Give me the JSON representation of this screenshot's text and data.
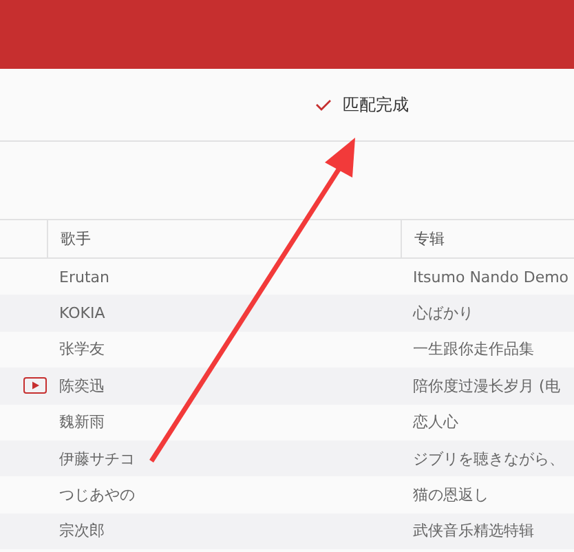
{
  "status": {
    "text": "匹配完成"
  },
  "table": {
    "columns": [
      "歌手",
      "专辑"
    ],
    "rows": [
      {
        "artist": "Erutan",
        "album": "Itsumo Nando Demo",
        "playing": false
      },
      {
        "artist": "KOKIA",
        "album": "心ばかり",
        "playing": false
      },
      {
        "artist": "张学友",
        "album": "一生跟你走作品集",
        "playing": false
      },
      {
        "artist": "陈奕迅",
        "album": "陪你度过漫长岁月 (电",
        "playing": true
      },
      {
        "artist": "魏新雨",
        "album": "恋人心",
        "playing": false
      },
      {
        "artist": "伊藤サチコ",
        "album": "ジブリを聴きながら、",
        "playing": false
      },
      {
        "artist": "つじあやの",
        "album": "猫の恩返し",
        "playing": false
      },
      {
        "artist": "宗次郎",
        "album": "武侠音乐精选特辑",
        "playing": false
      }
    ]
  }
}
